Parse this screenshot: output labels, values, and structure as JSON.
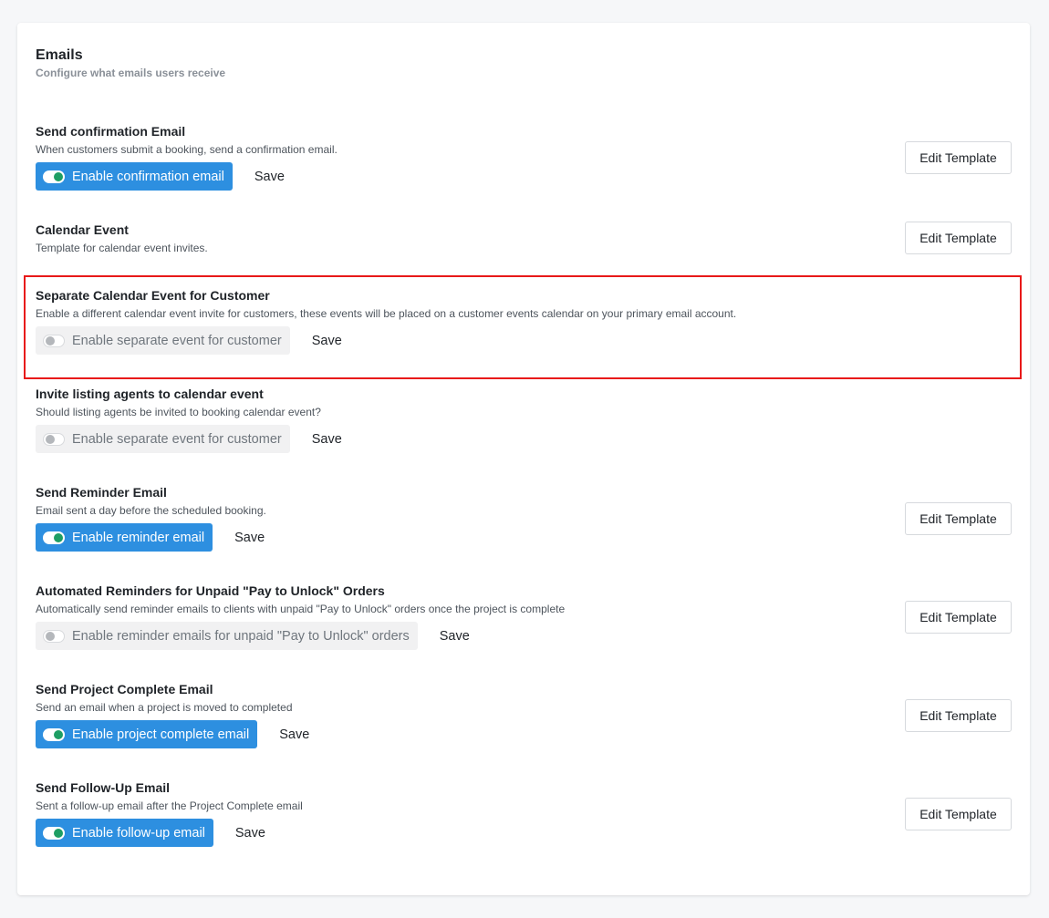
{
  "card": {
    "title": "Emails",
    "subtitle": "Configure what emails users receive"
  },
  "sections": [
    {
      "title": "Send confirmation Email",
      "description": "When customers submit a booking, send a confirmation email.",
      "toggle_label": "Enable confirmation email",
      "toggle_on": true,
      "save_label": "Save",
      "edit_label": "Edit Template"
    },
    {
      "title": "Calendar Event",
      "description": "Template for calendar event invites.",
      "edit_label": "Edit Template"
    },
    {
      "title": "Separate Calendar Event for Customer",
      "description": "Enable a different calendar event invite for customers, these events will be placed on a customer events calendar on your primary email account.",
      "toggle_label": "Enable separate event for customer",
      "toggle_on": false,
      "save_label": "Save"
    },
    {
      "title": "Invite listing agents to calendar event",
      "description": "Should listing agents be invited to booking calendar event?",
      "toggle_label": "Enable separate event for customer",
      "toggle_on": false,
      "save_label": "Save"
    },
    {
      "title": "Send Reminder Email",
      "description": "Email sent a day before the scheduled booking.",
      "toggle_label": "Enable reminder email",
      "toggle_on": true,
      "save_label": "Save",
      "edit_label": "Edit Template"
    },
    {
      "title": "Automated Reminders for Unpaid \"Pay to Unlock\" Orders",
      "description": "Automatically send reminder emails to clients with unpaid \"Pay to Unlock\" orders once the project is complete",
      "toggle_label": "Enable reminder emails for unpaid \"Pay to Unlock\" orders",
      "toggle_on": false,
      "save_label": "Save",
      "edit_label": "Edit Template"
    },
    {
      "title": "Send Project Complete Email",
      "description": "Send an email when a project is moved to completed",
      "toggle_label": "Enable project complete email",
      "toggle_on": true,
      "save_label": "Save",
      "edit_label": "Edit Template"
    },
    {
      "title": "Send Follow-Up Email",
      "description": "Sent a follow-up email after the Project Complete email",
      "toggle_label": "Enable follow-up email",
      "toggle_on": true,
      "save_label": "Save",
      "edit_label": "Edit Template"
    }
  ],
  "colors": {
    "toggle_on_bg": "#2d8fe0",
    "toggle_off_bg": "#f1f1f2",
    "switch_on_knob": "#1e9e63",
    "highlight_border": "#e81919"
  }
}
